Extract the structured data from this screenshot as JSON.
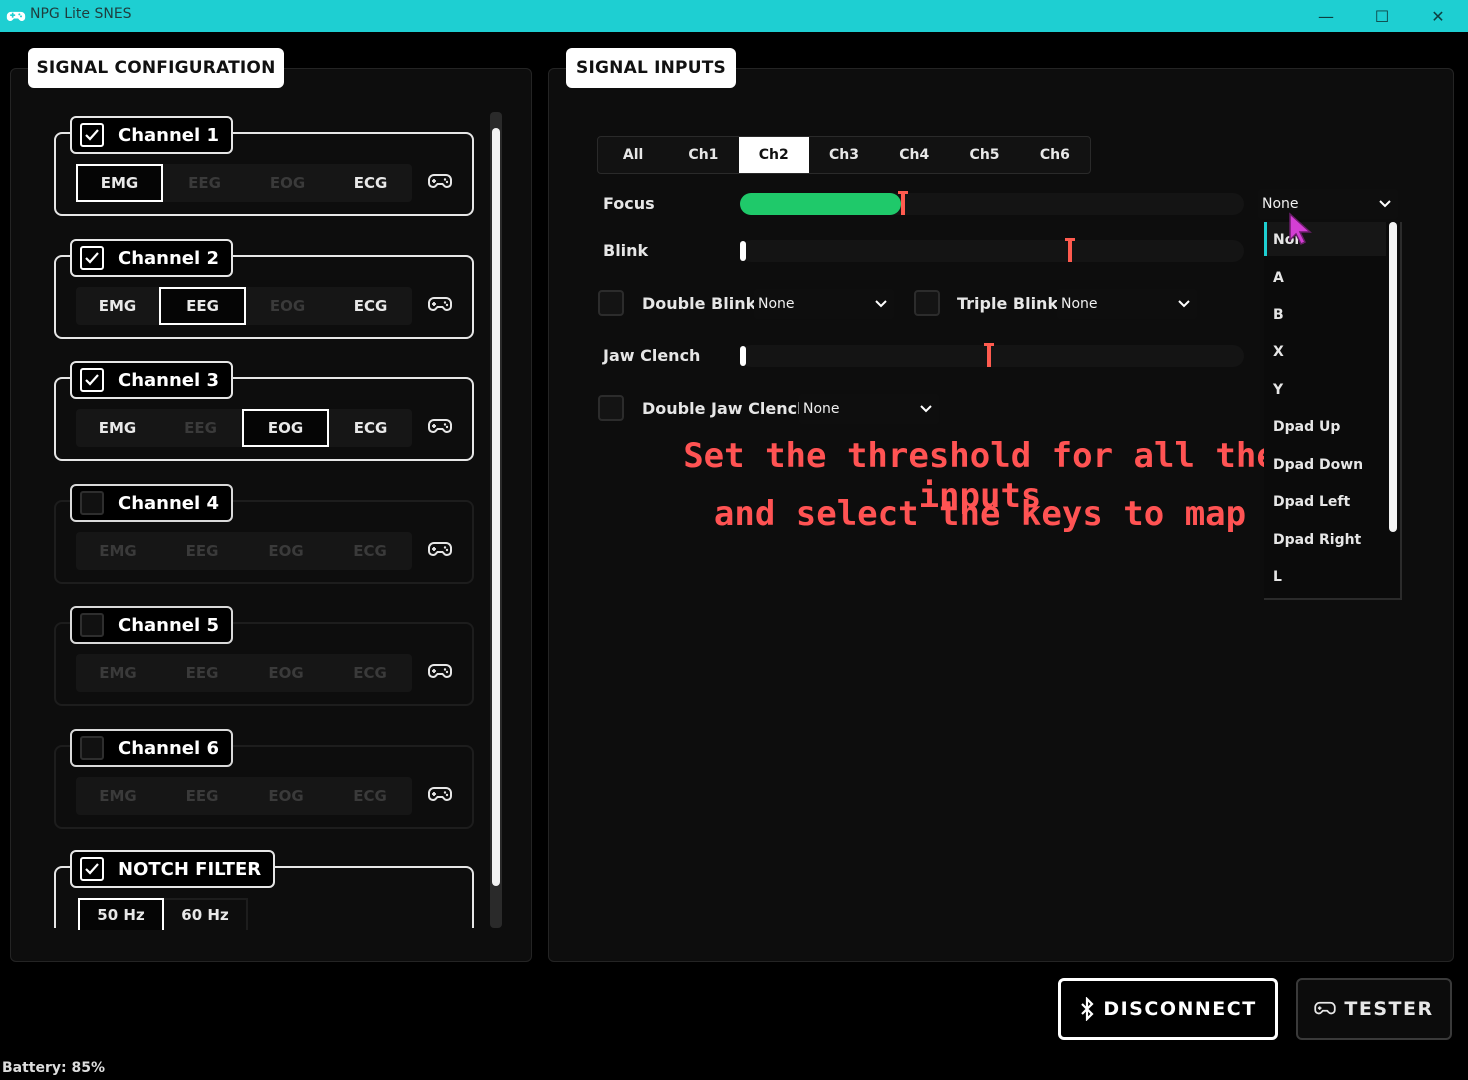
{
  "window": {
    "title": "NPG Lite SNES",
    "controls": [
      "—",
      "☐",
      "✕"
    ]
  },
  "left_panel": {
    "tab_label": "SIGNAL CONFIGURATION",
    "channels": [
      {
        "label": "Channel 1",
        "checked": true,
        "signals": [
          "EMG",
          "EEG",
          "EOG",
          "ECG"
        ],
        "selected": "EMG"
      },
      {
        "label": "Channel 2",
        "checked": true,
        "signals": [
          "EMG",
          "EEG",
          "EOG",
          "ECG"
        ],
        "selected": "EEG"
      },
      {
        "label": "Channel 3",
        "checked": true,
        "signals": [
          "EMG",
          "EEG",
          "EOG",
          "ECG"
        ],
        "selected": "EOG"
      },
      {
        "label": "Channel 4",
        "checked": false,
        "signals": [
          "EMG",
          "EEG",
          "EOG",
          "ECG"
        ],
        "selected": ""
      },
      {
        "label": "Channel 5",
        "checked": false,
        "signals": [
          "EMG",
          "EEG",
          "EOG",
          "ECG"
        ],
        "selected": ""
      },
      {
        "label": "Channel 6",
        "checked": false,
        "signals": [
          "EMG",
          "EEG",
          "EOG",
          "ECG"
        ],
        "selected": ""
      }
    ],
    "notch": {
      "label": "NOTCH FILTER",
      "checked": true,
      "options": [
        "50 Hz",
        "60 Hz"
      ],
      "selected": "50 Hz"
    }
  },
  "right_panel": {
    "tab_label": "SIGNAL INPUTS",
    "tabs": [
      "All",
      "Ch1",
      "Ch2",
      "Ch3",
      "Ch4",
      "Ch5",
      "Ch6"
    ],
    "active_tab": "Ch2",
    "focus": {
      "label": "Focus",
      "level": 0.32,
      "threshold": 0.32
    },
    "blink": {
      "label": "Blink",
      "level": 0.0,
      "threshold": 0.65
    },
    "double_blink": {
      "label": "Double Blink",
      "value": "None"
    },
    "triple_blink": {
      "label": "Triple Blink",
      "value": "None"
    },
    "jaw_clench": {
      "label": "Jaw Clench",
      "level": 0.0,
      "threshold": 0.49
    },
    "double_jaw_clench": {
      "label": "Double Jaw Clench",
      "value": "None"
    },
    "focus_key": {
      "value": "None"
    },
    "key_options": [
      "Non",
      "A",
      "B",
      "X",
      "Y",
      "Dpad Up",
      "Dpad Down",
      "Dpad Left",
      "Dpad Right",
      "L"
    ],
    "annotation_line1": "Set the threshold for all the inputs",
    "annotation_line2": "and select the keys to map"
  },
  "buttons": {
    "disconnect": "DISCONNECT",
    "tester": "TESTER"
  },
  "status": {
    "battery": "Battery: 85%"
  },
  "colors": {
    "titlebar": "#1ecfd2",
    "focus_fill": "#1fc96a",
    "threshold": "#ff5b4f",
    "annotation": "#ff5353",
    "cursor": "#d43fd4"
  }
}
